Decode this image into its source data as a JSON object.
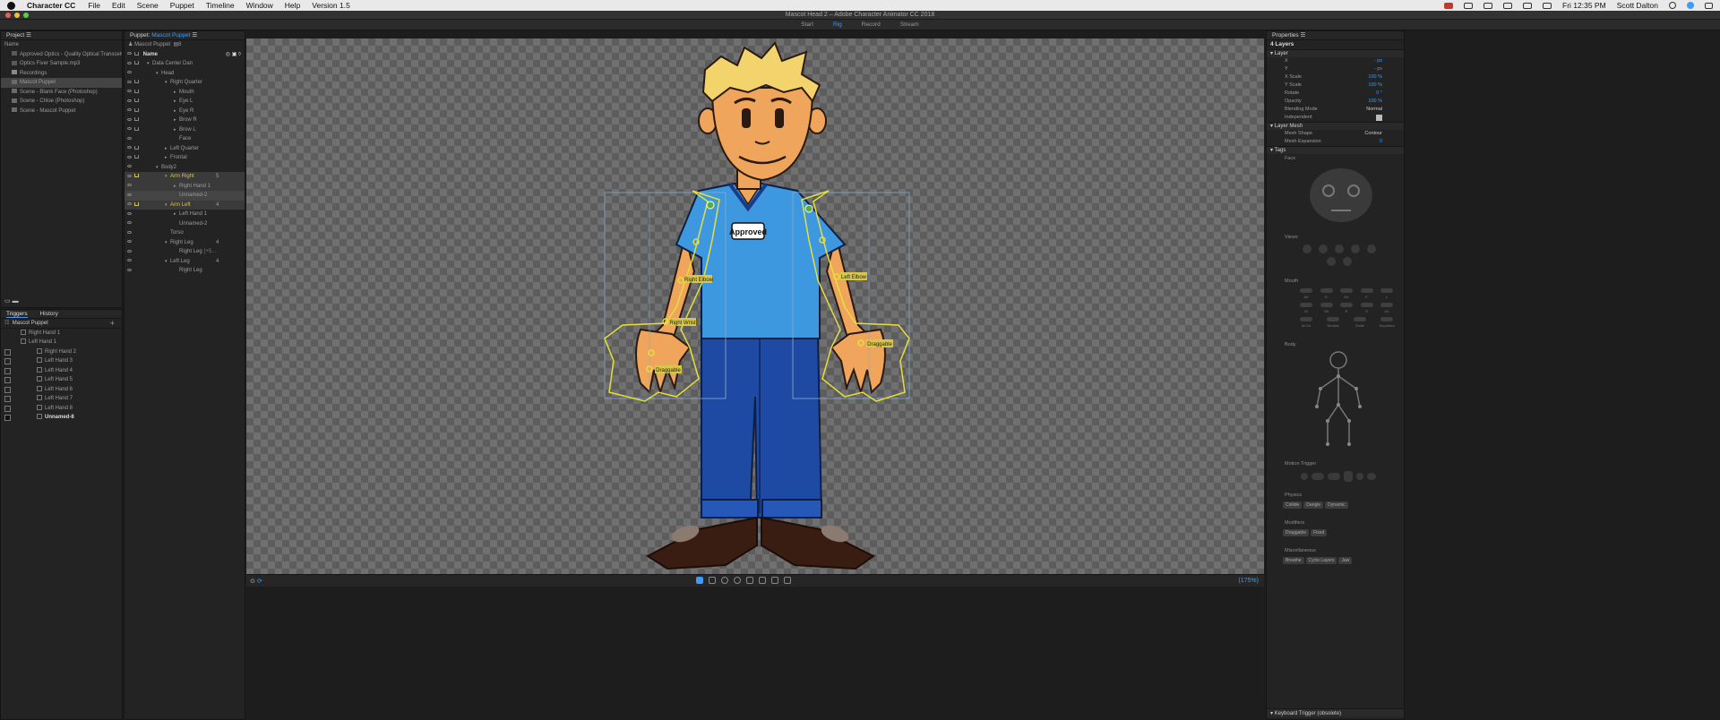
{
  "menubar": {
    "app_name": "Character CC",
    "items": [
      "File",
      "Edit",
      "Scene",
      "Puppet",
      "Timeline",
      "Window",
      "Help",
      "Version 1.5"
    ],
    "clock": "Fri 12:35 PM",
    "user": "Scott Dalton"
  },
  "window_title": "Mascot Head 2 – Adobe Character Animator CC 2018",
  "modes": [
    "Start",
    "Rig",
    "Record",
    "Stream"
  ],
  "active_mode": "Rig",
  "project": {
    "title": "Project",
    "col_name": "Name",
    "items": [
      {
        "label": "Approved Optics - Quality Optical Transceivers...",
        "type": "audio"
      },
      {
        "label": "Optics Fiver Sample.mp3",
        "type": "audio"
      },
      {
        "label": "Recordings",
        "type": "folder"
      },
      {
        "label": "Mascot Puppet",
        "type": "puppet",
        "selected": true
      },
      {
        "label": "Scene - Blank Face (Photoshop)",
        "type": "scene"
      },
      {
        "label": "Scene - Chloe (Photoshop)",
        "type": "scene"
      },
      {
        "label": "Scene - Mascot Puppet",
        "type": "scene"
      }
    ]
  },
  "triggers": {
    "tabs": [
      "Triggers",
      "History"
    ],
    "puppet": "Mascot Puppet",
    "items": [
      {
        "label": "Right Hand 1",
        "indent": 1,
        "key": ""
      },
      {
        "label": "Left Hand 1",
        "indent": 1,
        "key": ""
      },
      {
        "label": "Right Hand 2",
        "indent": 2,
        "key": "1"
      },
      {
        "label": "Left Hand 3",
        "indent": 2,
        "key": "2"
      },
      {
        "label": "Left Hand 4",
        "indent": 2,
        "key": "3"
      },
      {
        "label": "Left Hand 5",
        "indent": 2,
        "key": "4"
      },
      {
        "label": "Left Hand 6",
        "indent": 2,
        "key": "5"
      },
      {
        "label": "Left Hand 7",
        "indent": 2,
        "key": "6"
      },
      {
        "label": "Left Hand 8",
        "indent": 2,
        "key": "7"
      },
      {
        "label": "Unnamed-8",
        "indent": 2,
        "key": "",
        "bold": true
      }
    ]
  },
  "puppet_panel": {
    "title_prefix": "Puppet:",
    "title_name": "Mascot Puppet",
    "sub_name": "Mascot Puppet",
    "sub_count": "8",
    "col_name": "Name",
    "layers": [
      {
        "label": "Data Center Dan",
        "indent": 1,
        "arrow": "v",
        "crown": true
      },
      {
        "label": "Head",
        "indent": 2,
        "arrow": "v",
        "crown": false
      },
      {
        "label": "Right Quarter",
        "indent": 3,
        "arrow": "v",
        "crown": true
      },
      {
        "label": "Mouth",
        "indent": 4,
        "arrow": ">",
        "crown": true
      },
      {
        "label": "Eye L",
        "indent": 4,
        "arrow": ">",
        "crown": true
      },
      {
        "label": "Eye R",
        "indent": 4,
        "arrow": ">",
        "crown": true
      },
      {
        "label": "Brow R",
        "indent": 4,
        "arrow": ">",
        "crown": true
      },
      {
        "label": "Brow L",
        "indent": 4,
        "arrow": ">",
        "crown": true
      },
      {
        "label": "Face",
        "indent": 4,
        "arrow": "",
        "crown": false
      },
      {
        "label": "Left Quarter",
        "indent": 3,
        "arrow": ">",
        "crown": true
      },
      {
        "label": "Frontal",
        "indent": 3,
        "arrow": ">",
        "crown": true
      },
      {
        "label": "Body2",
        "indent": 2,
        "arrow": "v",
        "crown": false
      },
      {
        "label": "Arm Right",
        "indent": 3,
        "arrow": "v",
        "crown": true,
        "hl": true,
        "yellow": true,
        "num": "5"
      },
      {
        "label": "Right Hand 1",
        "indent": 4,
        "arrow": ">",
        "crown": false,
        "hl": true
      },
      {
        "label": "Unnamed-2",
        "indent": 4,
        "arrow": "",
        "crown": false,
        "hl": true,
        "sel": true
      },
      {
        "label": "Arm Left",
        "indent": 3,
        "arrow": "v",
        "crown": true,
        "hl": true,
        "yellow": true,
        "num": "4"
      },
      {
        "label": "Left Hand 1",
        "indent": 4,
        "arrow": ">",
        "crown": false
      },
      {
        "label": "Unnamed-2",
        "indent": 4,
        "arrow": "",
        "crown": false
      },
      {
        "label": "Torso",
        "indent": 3,
        "arrow": "",
        "crown": false
      },
      {
        "label": "Right Leg",
        "indent": 3,
        "arrow": "v",
        "crown": false,
        "num": "4"
      },
      {
        "label": "Right Leg",
        "indent": 4,
        "arrow": "",
        "crown": false,
        "extra": "[+5..."
      },
      {
        "label": "Left Leg",
        "indent": 3,
        "arrow": "v",
        "crown": false,
        "num": "4"
      },
      {
        "label": "Right Leg",
        "indent": 4,
        "arrow": "",
        "crown": false
      }
    ]
  },
  "scene": {
    "badge_text": "Approved",
    "handles": [
      {
        "label": "Right Elbow"
      },
      {
        "label": "Right Wrist"
      },
      {
        "label": "Draggable"
      },
      {
        "label": "Left Elbow"
      },
      {
        "label": "Draggable"
      }
    ],
    "zoom": "(175%)"
  },
  "properties": {
    "title": "Properties",
    "layer_count": "4 Layers",
    "layer_section": "Layer",
    "fields": [
      {
        "label": "X",
        "value": "- px"
      },
      {
        "label": "Y",
        "value": "- px"
      },
      {
        "label": "X Scale",
        "value": "100 %"
      },
      {
        "label": "Y Scale",
        "value": "100 %"
      },
      {
        "label": "Rotate",
        "value": "0 °"
      },
      {
        "label": "Opacity",
        "value": "100 %"
      },
      {
        "label": "Blending Mode",
        "value": "Normal"
      },
      {
        "label": "Independent",
        "value": ""
      }
    ],
    "mesh_section": "Layer Mesh",
    "mesh_shape_label": "Mesh Shape",
    "mesh_shape_value": "Contour",
    "mesh_expansion_label": "Mesh Expansion",
    "mesh_expansion_value": "0",
    "tags_section": "Tags",
    "face_label": "Face",
    "views_label": "Views",
    "mouth_label": "Mouth",
    "mouth_row1": [
      "Ah",
      "D",
      "Ee",
      "F",
      "L"
    ],
    "mouth_row2": [
      "M",
      "Oh",
      "R",
      "S",
      "Uh"
    ],
    "mouth_row3": [
      "W-Oo",
      "Neutral",
      "Smile",
      "Surprised"
    ],
    "body_label": "Body",
    "motion_label": "Motion Trigger",
    "physics_label": "Physics",
    "physics_chips": [
      "Collide",
      "Dangle",
      "Dynamic"
    ],
    "modifiers_label": "Modifiers",
    "modifiers_chips": [
      "Draggable",
      "Fixed"
    ],
    "misc_label": "Miscellaneous",
    "misc_chips": [
      "Breathe",
      "Cycle Layers",
      "Jaw"
    ],
    "keyboard_trigger": "Keyboard Trigger (obsolete)"
  },
  "colors": {
    "accent": "#3f9cf5",
    "highlight_yellow": "#d8c64a",
    "panel_bg": "#232323"
  }
}
